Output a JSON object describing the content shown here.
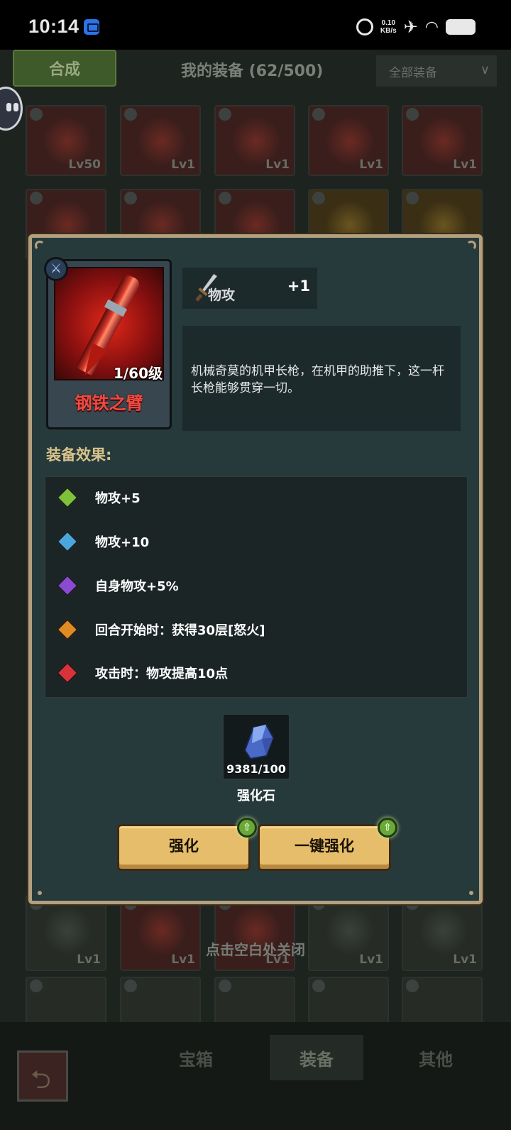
{
  "statusbar": {
    "time": "10:14",
    "speed_value": "0.10",
    "speed_unit": "KB/s",
    "icons": [
      "chat-icon",
      "alarm-icon",
      "airplane-icon",
      "wifi-icon",
      "battery-icon"
    ]
  },
  "background": {
    "synth_label": "合成",
    "title": "我的装备 (62/500)",
    "filter_label": "全部装备",
    "row1_levels": [
      "Lv50",
      "Lv1",
      "Lv1",
      "Lv1",
      "Lv1"
    ],
    "row_bottom_levels": [
      "Lv1",
      "Lv1",
      "Lv1",
      "Lv1",
      "Lv1"
    ],
    "close_hint": "点击空白处关闭",
    "nav": [
      "宝箱",
      "装备",
      "其他"
    ],
    "active_nav": "装备"
  },
  "dialog": {
    "item": {
      "name": "钢铁之臂",
      "level": "1/60级",
      "type_icon": "sword-icon"
    },
    "stat": {
      "label": "物攻",
      "value": "+1"
    },
    "description": "机械奇莫的机甲长枪，在机甲的助推下，这一杆长枪能够贯穿一切。",
    "effects_title": "装备效果:",
    "effects": [
      {
        "text": "物攻+5",
        "color": "#7cc23a"
      },
      {
        "text": "物攻+10",
        "color": "#4aa6dc"
      },
      {
        "text": "自身物攻+5%",
        "color": "#8a4ad2"
      },
      {
        "text": "回合开始时：获得30层[怒火]",
        "color": "#e08a22"
      },
      {
        "text": "攻击时：物攻提高10点",
        "color": "#d8323a"
      }
    ],
    "material": {
      "count": "9381/100",
      "name": "强化石"
    },
    "buttons": {
      "enhance": "强化",
      "enhance_all": "一键强化"
    }
  }
}
